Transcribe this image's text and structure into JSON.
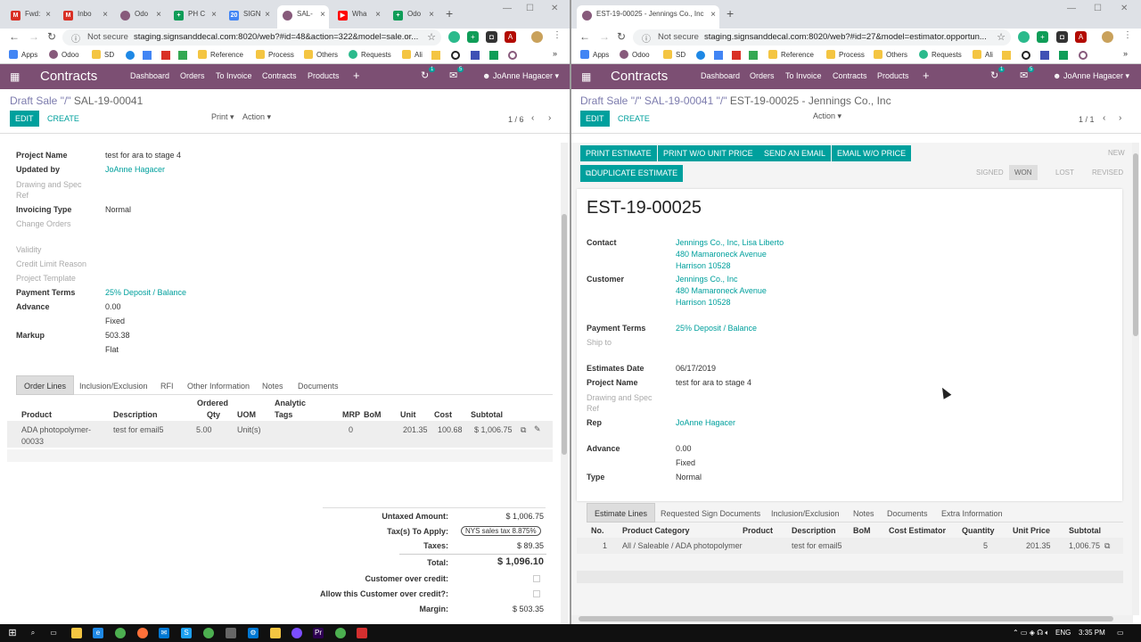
{
  "left_window": {
    "tabs": [
      {
        "label": "Fwd:",
        "icon": "gmail-icon"
      },
      {
        "label": "Inbo",
        "icon": "gmail-icon"
      },
      {
        "label": "Odo",
        "icon": "odoo-icon"
      },
      {
        "label": "PH C",
        "icon": "sheets-icon"
      },
      {
        "label": "SIGN",
        "icon": "calendar-icon"
      },
      {
        "label": "SAL-",
        "icon": "odoo-icon",
        "active": true
      },
      {
        "label": "Wha",
        "icon": "youtube-icon"
      },
      {
        "label": "Odo",
        "icon": "sheets-icon"
      }
    ],
    "address": {
      "security": "Not secure",
      "url": "staging.signsanddecal.com:8020/web?#id=48&action=322&model=sale.or..."
    },
    "bookmarks": [
      "Apps",
      "Odoo",
      "SD",
      "Reference",
      "Process",
      "Others",
      "Requests",
      "Ali"
    ],
    "navbar": {
      "brand": "Contracts",
      "menu": [
        "Dashboard",
        "Orders",
        "To Invoice",
        "Contracts",
        "Products"
      ],
      "user": "JoAnne Hagacer",
      "badge1": "1",
      "badge2": "5"
    },
    "breadcrumb": {
      "parent": "Draft Sale \"/\"",
      "current": "SAL-19-00041"
    },
    "buttons": {
      "edit": "EDIT",
      "create": "CREATE",
      "print": "Print",
      "action": "Action"
    },
    "pager": "1 / 6",
    "fields": [
      {
        "label": "Project Name",
        "value": "test for ara to stage 4"
      },
      {
        "label": "Updated by",
        "value": "JoAnne Hagacer"
      },
      {
        "label": "Drawing and Spec Ref",
        "value": ""
      },
      {
        "label": "Invoicing Type",
        "value": "Normal"
      },
      {
        "label": "Change Orders",
        "value": ""
      },
      {
        "label": "Validity",
        "value": ""
      },
      {
        "label": "Credit Limit Reason",
        "value": ""
      },
      {
        "label": "Project Template",
        "value": ""
      },
      {
        "label": "Payment Terms",
        "value": "25% Deposit / Balance"
      },
      {
        "label": "Advance",
        "value": "0.00",
        "sub": "Fixed"
      },
      {
        "label": "Markup",
        "value": "503.38",
        "sub": "Flat"
      }
    ],
    "notebook_tabs": [
      "Order Lines",
      "Inclusion/Exclusion",
      "RFI",
      "Other Information",
      "Notes",
      "Documents"
    ],
    "columns": {
      "product": "Product",
      "description": "Description",
      "ordered": "Ordered",
      "qty": "Qty",
      "uom": "UOM",
      "analytic": "Analytic",
      "tags": "Tags",
      "mrp": "MRP",
      "bom": "BoM",
      "unit": "Unit",
      "cost": "Cost",
      "subtotal": "Subtotal"
    },
    "line": {
      "product": "ADA photopolymer-",
      "product2": "00033",
      "description": "test for email5",
      "qty": "5.00",
      "uom": "Unit(s)",
      "mrp": "0",
      "unit": "201.35",
      "cost": "100.68",
      "subtotal": "$ 1,006.75"
    },
    "totals": {
      "untaxed_label": "Untaxed Amount:",
      "untaxed": "$ 1,006.75",
      "tax_label": "Tax(s) To Apply:",
      "tax_pill": "NYS sales tax 8.875%",
      "taxes_label": "Taxes:",
      "taxes": "$ 89.35",
      "total_label": "Total:",
      "total": "$ 1,096.10",
      "over_credit": "Customer over credit:",
      "allow_over_credit": "Allow this Customer over credit?:",
      "margin_label": "Margin:",
      "margin": "$ 503.35"
    }
  },
  "right_window": {
    "tab": {
      "label": "EST-19-00025 - Jennings Co., Inc"
    },
    "address": {
      "security": "Not secure",
      "url": "staging.signsanddecal.com:8020/web?#id=27&model=estimator.opportun..."
    },
    "bookmarks": [
      "Apps",
      "Odoo",
      "SD",
      "Reference",
      "Process",
      "Others",
      "Requests",
      "Ali"
    ],
    "navbar": {
      "brand": "Contracts",
      "menu": [
        "Dashboard",
        "Orders",
        "To Invoice",
        "Contracts",
        "Products"
      ],
      "user": "JoAnne Hagacer",
      "badge1": "1",
      "badge2": "5"
    },
    "breadcrumb": {
      "p1": "Draft Sale \"/\"",
      "p2": "SAL-19-00041 \"/\"",
      "current": "EST-19-00025 - Jennings Co., Inc"
    },
    "buttons": {
      "edit": "EDIT",
      "create": "CREATE",
      "action": "Action",
      "print_estimate": "PRINT ESTIMATE",
      "print_wo": "PRINT W/O UNIT PRICE",
      "send_email": "SEND AN EMAIL",
      "email_wo": "EMAIL W/O PRICE",
      "duplicate": "DUPLICATE ESTIMATE"
    },
    "pager": "1 / 1",
    "statusbar": [
      "NEW",
      "SIGNED",
      "WON",
      "LOST",
      "REVISED"
    ],
    "title": "EST-19-00025",
    "contact": {
      "label": "Contact",
      "l1": "Jennings Co., Inc, Lisa Liberto",
      "l2": "480 Mamaroneck Avenue",
      "l3": "Harrison 10528"
    },
    "customer": {
      "label": "Customer",
      "l1": "Jennings Co., Inc",
      "l2": "480 Mamaroneck Avenue",
      "l3": "Harrison 10528"
    },
    "payment_terms": {
      "label": "Payment Terms",
      "value": "25% Deposit / Balance"
    },
    "ship_to": "Ship to",
    "estimates_date": {
      "label": "Estimates Date",
      "value": "06/17/2019"
    },
    "project_name": {
      "label": "Project Name",
      "value": "test for ara to stage 4"
    },
    "drawing": "Drawing and Spec Ref",
    "rep": {
      "label": "Rep",
      "value": "JoAnne Hagacer"
    },
    "advance": {
      "label": "Advance",
      "value": "0.00",
      "sub": "Fixed"
    },
    "type": {
      "label": "Type",
      "value": "Normal"
    },
    "notebook_tabs": [
      "Estimate Lines",
      "Requested Sign Documents",
      "Inclusion/Exclusion",
      "Notes",
      "Documents",
      "Extra Information"
    ],
    "columns": [
      "No.",
      "Product Category",
      "Product",
      "Description",
      "BoM",
      "Cost Estimator",
      "Quantity",
      "Unit Price",
      "Subtotal"
    ],
    "line": {
      "no": "1",
      "category": "All / Saleable / ADA photopolymer",
      "description": "test for email5",
      "qty": "5",
      "unit_price": "201.35",
      "subtotal": "1,006.75"
    }
  },
  "taskbar": {
    "lang": "ENG",
    "time": "3:35 PM"
  },
  "colors": {
    "navbar": "#7c4f73",
    "accent": "#00a09d"
  }
}
